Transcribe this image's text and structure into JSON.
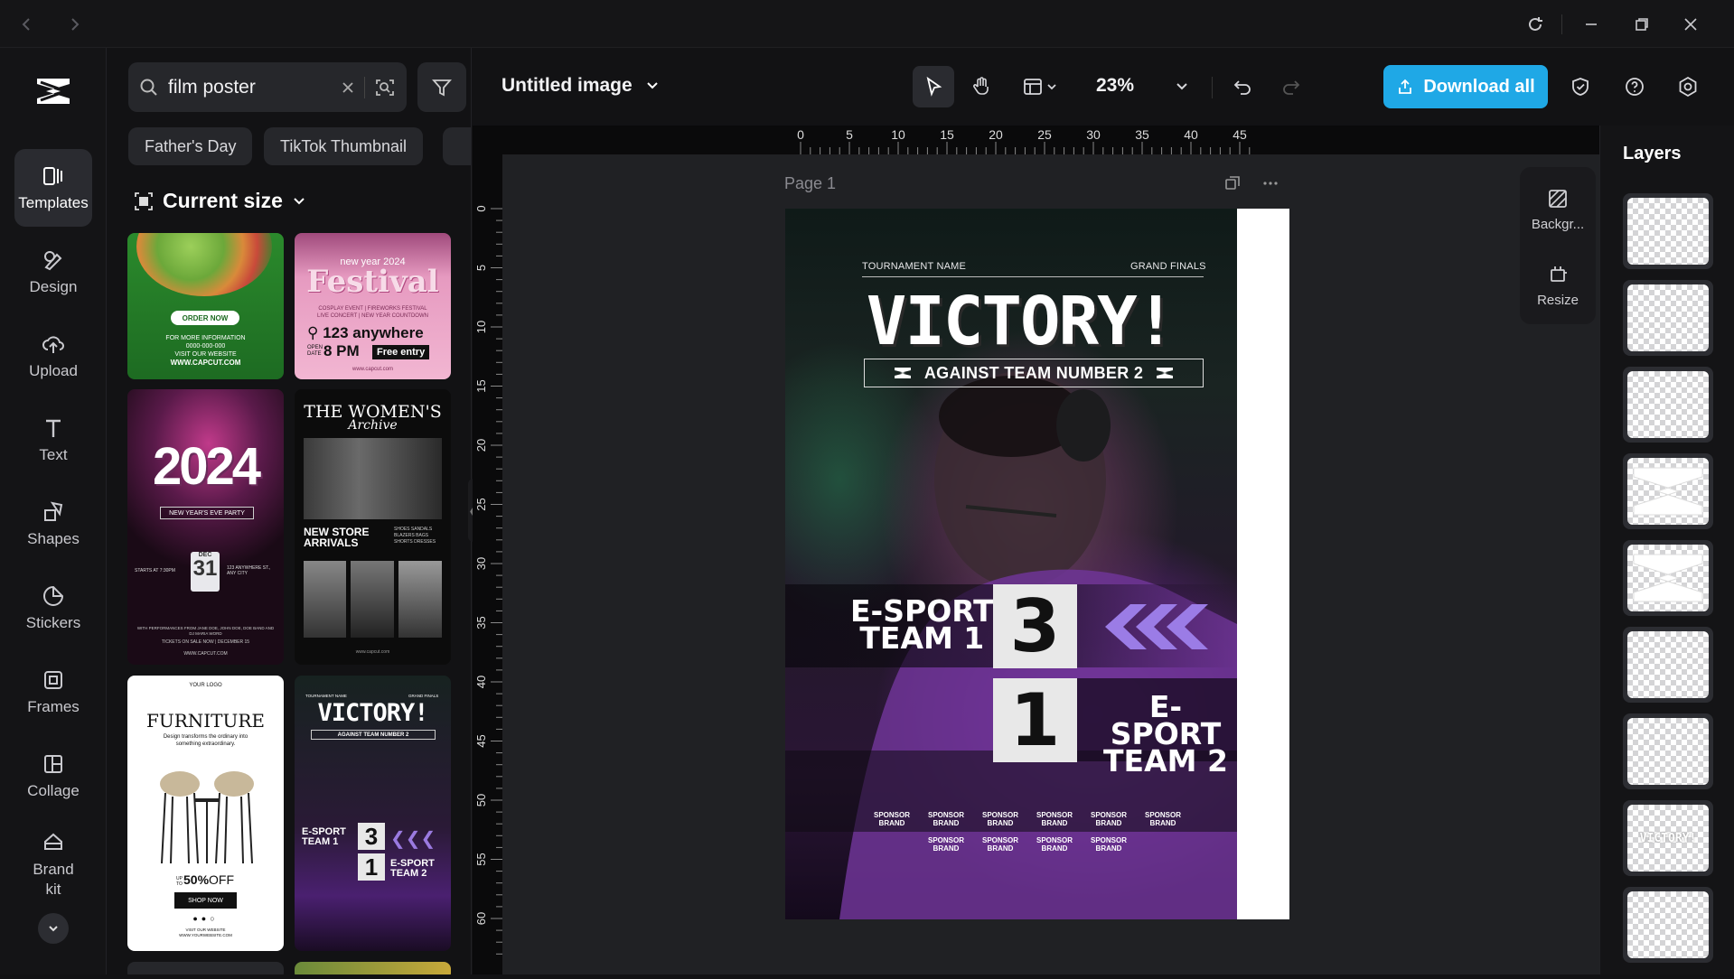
{
  "window": {
    "controls": [
      "back",
      "forward",
      "refresh",
      "minimize",
      "restore",
      "close"
    ]
  },
  "nav": {
    "items": [
      {
        "label": "Templates",
        "icon": "templates-icon",
        "active": true
      },
      {
        "label": "Design",
        "icon": "design-icon"
      },
      {
        "label": "Upload",
        "icon": "upload-icon"
      },
      {
        "label": "Text",
        "icon": "text-icon"
      },
      {
        "label": "Shapes",
        "icon": "shapes-icon"
      },
      {
        "label": "Stickers",
        "icon": "stickers-icon"
      },
      {
        "label": "Frames",
        "icon": "frames-icon"
      },
      {
        "label": "Collage",
        "icon": "collage-icon"
      },
      {
        "label": "Brand kit",
        "icon": "brand-kit-icon"
      }
    ]
  },
  "panel": {
    "search_value": "film poster",
    "chips": [
      "Father's Day",
      "TikTok Thumbnail"
    ],
    "current_size": "Current size",
    "templates": {
      "food": {
        "btn": "ORDER NOW",
        "info": "FOR MORE INFORMATION",
        "phone": "0000-000-000",
        "visit": "VISIT OUR WEBSITE",
        "url": "WWW.CAPCUT.COM"
      },
      "festival": {
        "top": "new year 2024",
        "title": "Festival",
        "sub1": "COSPLAY EVENT  |  FIREWORKS FESTIVAL",
        "sub2": "LIVE CONCERT  |  NEW YEAR COUNTDOWN",
        "addr": "123 anywhere",
        "time": "8 PM",
        "open": "OPEN DATE",
        "free": "Free entry",
        "site": "www.capcut.com"
      },
      "party": {
        "year": "2024",
        "label": "NEW YEAR'S EVE PARTY",
        "month": "DEC",
        "day": "31",
        "left": "STARTS AT 7:30PM",
        "right": "123 ANYWHERE ST., ANY CITY",
        "perf": "WITH PERFORMANCES FROM JANE DOE, JOHN DOE, DOE BAND AND DJ MARIA WORD",
        "tickets": "TICKETS ON SALE NOW | DECEMBER 15",
        "url": "WWW.CAPCUT.COM"
      },
      "womens": {
        "title": "THE WOMEN'S",
        "script": "Archive",
        "arrivals": "NEW STORE ARRIVALS",
        "items": "SHOES  SANDALS  BLAZERS  BAGS  SHORTS  DRESSES",
        "url": "www.capcut.com"
      },
      "furniture": {
        "logo": "YOUR LOGO",
        "title": "FURNITURE",
        "tagline": "Design transforms the ordinary into something extraordinary.",
        "up": "UP TO",
        "discount": "50%",
        "off": "OFF",
        "shop": "SHOP NOW",
        "visit": "VISIT OUR WEBSITE",
        "site": "WWW.YOURWEBSITE.COM"
      },
      "victory_mini": {
        "tl": "TOURNAMENT NAME",
        "tr": "GRAND FINALS",
        "title": "VICTORY!",
        "against": "AGAINST TEAM NUMBER 2",
        "t1": "E-SPORT TEAM 1",
        "s1": "3",
        "s2": "1",
        "t2": "E-SPORT TEAM 2"
      }
    }
  },
  "topbar": {
    "doc_title": "Untitled image",
    "zoom": "23%",
    "download": "Download all"
  },
  "ruler": {
    "top": [
      "0",
      "5",
      "10",
      "15",
      "20",
      "25",
      "30",
      "35",
      "40",
      "45"
    ],
    "left": [
      "0",
      "5",
      "10",
      "15",
      "20",
      "25",
      "30",
      "35",
      "40",
      "45",
      "50",
      "55",
      "60"
    ]
  },
  "canvas": {
    "page_label": "Page 1"
  },
  "poster": {
    "tournament": "TOURNAMENT NAME",
    "grand_finals": "GRAND FINALS",
    "title": "VICTORY!",
    "against": "AGAINST TEAM NUMBER 2",
    "team1_line1": "E-SPORT",
    "team1_line2": "TEAM 1",
    "score1": "3",
    "score2": "1",
    "team2_line1": "E-SPORT",
    "team2_line2": "TEAM 2",
    "sponsor": "SPONSOR BRAND",
    "sponsor_count": 10
  },
  "side_tools": [
    {
      "label": "Backgr...",
      "icon": "background-icon"
    },
    {
      "label": "Resize",
      "icon": "resize-icon"
    }
  ],
  "layers": {
    "title": "Layers",
    "items": [
      {
        "type": "empty"
      },
      {
        "type": "empty"
      },
      {
        "type": "empty"
      },
      {
        "type": "logo"
      },
      {
        "type": "logo"
      },
      {
        "type": "empty"
      },
      {
        "type": "empty"
      },
      {
        "type": "text",
        "text": "VICTORY!"
      },
      {
        "type": "empty"
      }
    ]
  },
  "colors": {
    "accent": "#1fa8e6",
    "bg": "#121214",
    "panel": "#26272b"
  }
}
